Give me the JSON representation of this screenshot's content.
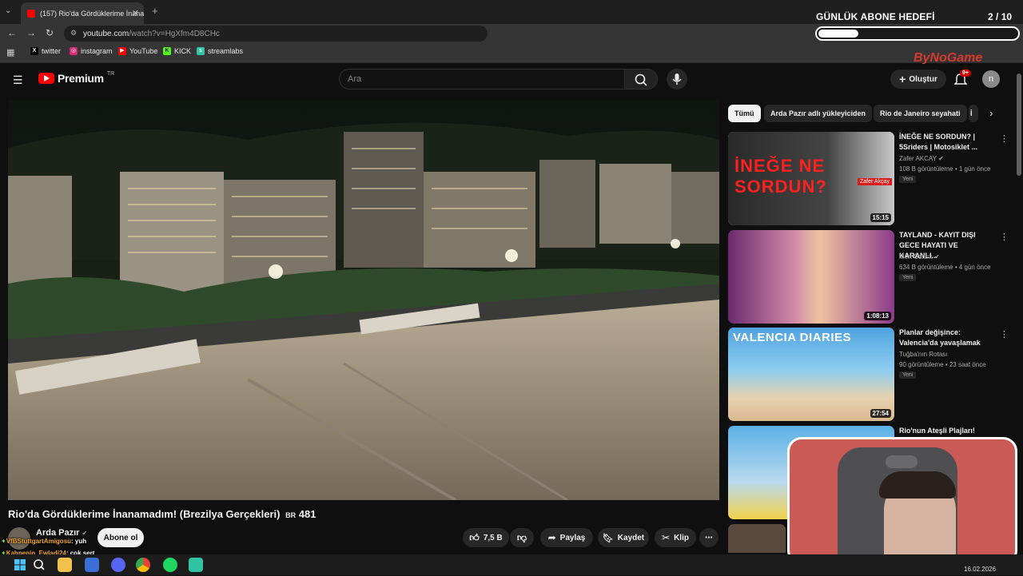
{
  "browser": {
    "tab_title": "(157) Rio'da Gördüklerime İnanamadım!",
    "url_host": "youtube.com",
    "url_path": "/watch?v=HgXfm4D8CHc",
    "new_tab_symbol": "+",
    "bookmarks": [
      {
        "label": "twitter",
        "icon": "x-icon",
        "color": "#000000",
        "glyph": "X"
      },
      {
        "label": "instagram",
        "icon": "instagram-icon",
        "color": "#d62976",
        "glyph": "◎"
      },
      {
        "label": "YouTube",
        "icon": "youtube-icon",
        "color": "#ff0000",
        "glyph": "▶"
      },
      {
        "label": "KICK",
        "icon": "kick-icon",
        "color": "#53fc18",
        "glyph": "K"
      },
      {
        "label": "streamlabs",
        "icon": "streamlabs-icon",
        "color": "#31c3a2",
        "glyph": "s"
      }
    ]
  },
  "youtube": {
    "logo_text": "Premium",
    "logo_region": "TR",
    "search_placeholder": "Ara",
    "create_label": "Oluştur",
    "notif_badge": "9+",
    "avatar_letter": "n",
    "brand_color": "#ff0000"
  },
  "video": {
    "title": "Rio'da Gördüklerime İnanamadım! (Brezilya Gerçekleri)",
    "country_code": "BR",
    "part_number": "481",
    "channel": "Arda Pazır",
    "subscribe_label": "Abone ol",
    "likes": "7,5 B",
    "share_label": "Paylaş",
    "save_label": "Kaydet",
    "clip_label": "Klip",
    "more_symbol": "⋯"
  },
  "chips": [
    "Tümü",
    "Arda Pazır adlı yükleyiciden",
    "Rio de Janeiro seyahati",
    "İ"
  ],
  "recommendations": [
    {
      "title": "İNEĞE NE SORDUN? | 5Sriders | Motosiklet ...",
      "channel": "Zafer AKCAY",
      "meta": "108 B görüntüleme • 1 gün önce",
      "badge": "Yeni",
      "duration": "15:15",
      "thumb_text": "İNEĞE NE SORDUN?",
      "thumb_name": "Zafer Akçay"
    },
    {
      "title": "TAYLAND - KAYIT DIŞI GECE HAYATI VE KARANLI...",
      "channel": "Mert Öztürk",
      "meta": "634 B görüntüleme • 4 gün önce",
      "badge": "Yeni",
      "duration": "1:08:13"
    },
    {
      "title": "Planlar değişince: Valencia'da yavaşlamak",
      "channel": "Tuğba'nın Rotası",
      "meta": "90 görüntüleme • 23 saat önce",
      "badge": "Yeni",
      "duration": "27:54",
      "thumb_text": "VALENCIA DIARIES"
    },
    {
      "title": "Rio'nun Ateşli Plajları!",
      "channel": "",
      "meta": "",
      "badge": "",
      "duration": ""
    }
  ],
  "overlay": {
    "goal_label": "GÜNLÜK ABONE HEDEFİ",
    "goal_current": "2",
    "goal_target": "/ 10",
    "goal_fraction": 0.2,
    "brand_watermark": "ByNoGame",
    "chat": [
      {
        "user": "VfBStuttgartAmigosu",
        "message": ": yuh",
        "color": "#f5a623"
      },
      {
        "user": "Kahpenin_Ewladi24",
        "message": ": çok sert",
        "color": "#f5a623"
      }
    ]
  },
  "taskbar": {
    "date": "16.02.2026",
    "apps": [
      "windows-icon",
      "search-icon",
      "file-explorer-icon",
      "app-icon",
      "discord-icon",
      "chrome-icon",
      "spotify-icon",
      "streamlabs-icon"
    ]
  }
}
